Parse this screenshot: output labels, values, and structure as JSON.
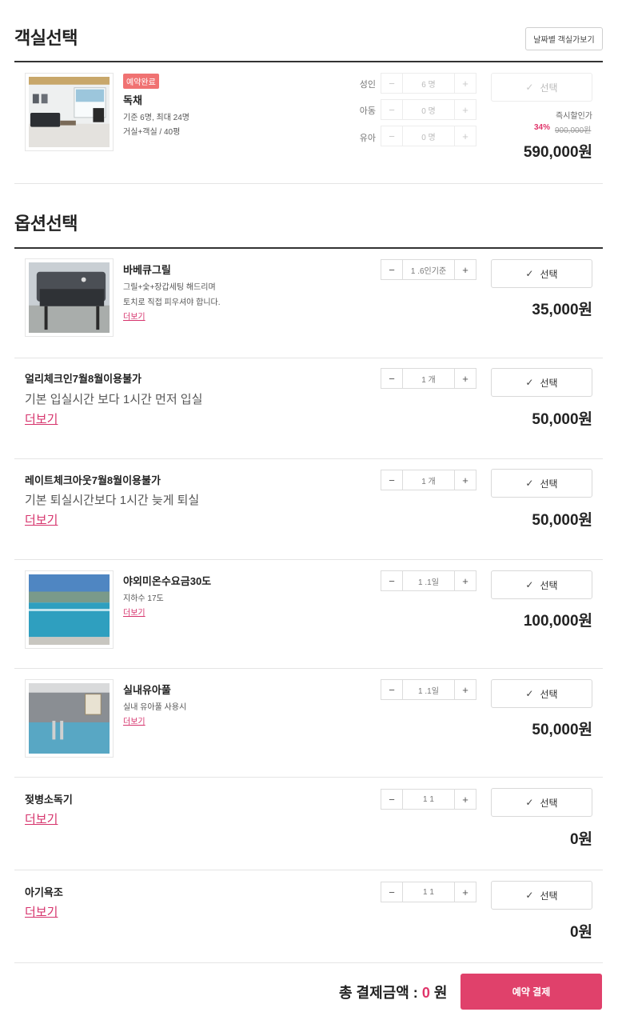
{
  "room_section": {
    "title": "객실선택",
    "date_button": "날짜별 객실가보기",
    "room": {
      "badge": "예약완료",
      "name": "독채",
      "capacity": "기준 6명, 최대 24명",
      "size": "거실+객실 / 40평",
      "guests": [
        {
          "label": "성인",
          "value": "6 명"
        },
        {
          "label": "아동",
          "value": "0 명"
        },
        {
          "label": "유아",
          "value": "0 명"
        }
      ],
      "select_label": "선택",
      "instant_discount": "즉시할인가",
      "discount_percent": "34%",
      "original_price": "900,000원",
      "price": "590,000원"
    }
  },
  "option_section": {
    "title": "옵션선택",
    "options": [
      {
        "name": "바베큐그릴",
        "desc_line1": "그릴+숯+장갑세팅 해드리며",
        "desc_line2": "토치로 직접 피우셔야 합니다.",
        "more": "더보기",
        "qty": "1 .6인기준",
        "select_label": "선택",
        "price": "35,000원"
      },
      {
        "name": "얼리체크인7월8월이용불가",
        "desc": "기본 입실시간 보다 1시간 먼저 입실",
        "more": "더보기",
        "qty": "1 개",
        "select_label": "선택",
        "price": "50,000원"
      },
      {
        "name": "레이트체크아웃7월8월이용불가",
        "desc": "기본 퇴실시간보다 1시간 늦게 퇴실",
        "more": "더보기",
        "qty": "1 개",
        "select_label": "선택",
        "price": "50,000원"
      },
      {
        "name": "야외미온수요금30도",
        "desc": "지하수 17도",
        "more": "더보기",
        "qty": "1 .1일",
        "select_label": "선택",
        "price": "100,000원"
      },
      {
        "name": "실내유아풀",
        "desc": "실내 유아풀 사용시",
        "more": "더보기",
        "qty": "1 .1일",
        "select_label": "선택",
        "price": "50,000원"
      },
      {
        "name": "젖병소독기",
        "more": "더보기",
        "qty": "1 1",
        "select_label": "선택",
        "price": "0원"
      },
      {
        "name": "아기욕조",
        "more": "더보기",
        "qty": "1 1",
        "select_label": "선택",
        "price": "0원"
      }
    ]
  },
  "footer": {
    "total_label": "총 결제금액 :",
    "total_amount": "0",
    "total_unit": "원",
    "pay_button": "예약 결제"
  },
  "stepper": {
    "minus": "−",
    "plus": "+"
  },
  "icons": {
    "check": "check-icon"
  },
  "colors": {
    "accent": "#e0416b",
    "badge": "#f07272",
    "divider": "#333333"
  }
}
